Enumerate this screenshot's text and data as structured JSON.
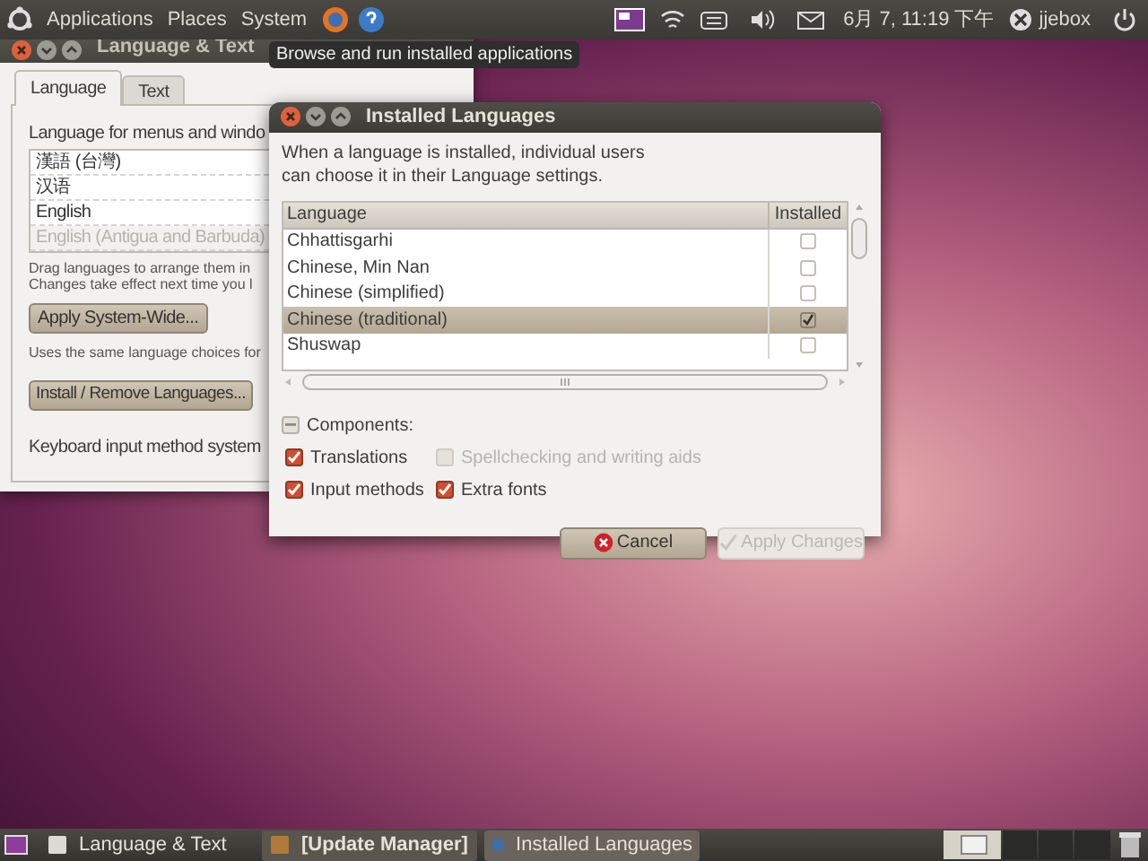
{
  "top_panel": {
    "menus": [
      "Applications",
      "Places",
      "System"
    ],
    "clock": "6月 7, 11:19 下午",
    "user": "jjebox"
  },
  "tooltip": "Browse and run installed applications",
  "language_window": {
    "title": "Language & Text",
    "tabs": [
      {
        "label": "Language",
        "selected": true
      },
      {
        "label": "Text",
        "selected": false
      }
    ],
    "list_heading": "Language for menus and windo",
    "languages": [
      {
        "label": "漢語 (台灣)",
        "disabled": false
      },
      {
        "label": "汉语",
        "disabled": false
      },
      {
        "label": "English",
        "disabled": false
      },
      {
        "label": "English (Antigua and Barbuda)",
        "disabled": true
      }
    ],
    "hint_lines": [
      "Drag languages to arrange them in",
      "Changes take effect next time you l"
    ],
    "apply_button": "Apply System-Wide...",
    "apply_hint": "Uses the same language choices for",
    "install_button": "Install / Remove Languages...",
    "keyboard_label": "Keyboard input method system"
  },
  "dialog": {
    "title": "Installed Languages",
    "intro_lines": [
      "When a language is installed, individual users",
      "can choose it in their Language settings."
    ],
    "columns": [
      "Language",
      "Installed"
    ],
    "rows": [
      {
        "language": "Chhattisgarhi",
        "installed": false,
        "selected": false
      },
      {
        "language": "Chinese, Min Nan",
        "installed": false,
        "selected": false
      },
      {
        "language": "Chinese (simplified)",
        "installed": false,
        "selected": false
      },
      {
        "language": "Chinese (traditional)",
        "installed": true,
        "selected": true
      },
      {
        "language": "Shuswap",
        "installed": false,
        "selected": false
      }
    ],
    "components": {
      "label": "Components:",
      "mixed": true
    },
    "options": [
      {
        "label": "Translations",
        "checked": true,
        "disabled": false
      },
      {
        "label": "Spellchecking and writing aids",
        "checked": false,
        "disabled": true
      },
      {
        "label": "Input methods",
        "checked": true,
        "disabled": false
      },
      {
        "label": "Extra fonts",
        "checked": true,
        "disabled": false
      }
    ],
    "buttons": [
      {
        "label": "Cancel",
        "disabled": false
      },
      {
        "label": "Apply Changes",
        "disabled": true
      }
    ]
  },
  "taskbar": {
    "items": [
      {
        "label": "Language & Text",
        "minimized": false,
        "selected": false
      },
      {
        "label": "[Update Manager]",
        "minimized": true,
        "selected": false
      },
      {
        "label": "Installed Languages",
        "minimized": false,
        "selected": true
      }
    ]
  }
}
